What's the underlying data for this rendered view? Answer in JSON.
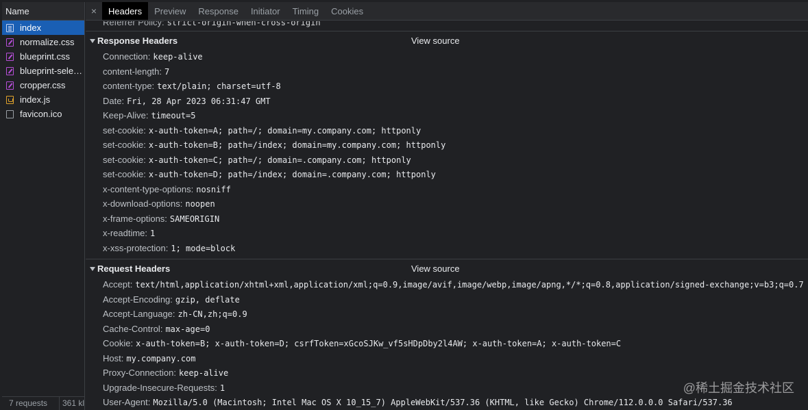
{
  "sidebar": {
    "header": "Name",
    "files": [
      {
        "name": "index",
        "icon": "document-icon",
        "type": "doc",
        "selected": true
      },
      {
        "name": "normalize.css",
        "icon": "css-file-icon",
        "type": "css"
      },
      {
        "name": "blueprint.css",
        "icon": "css-file-icon",
        "type": "css"
      },
      {
        "name": "blueprint-sele…",
        "icon": "css-file-icon",
        "type": "css"
      },
      {
        "name": "cropper.css",
        "icon": "css-file-icon",
        "type": "css"
      },
      {
        "name": "index.js",
        "icon": "js-file-icon",
        "type": "js"
      },
      {
        "name": "favicon.ico",
        "icon": "image-file-icon",
        "type": "blank"
      }
    ],
    "footer": {
      "requests": "7 requests",
      "size": "361 kl"
    }
  },
  "tabs": {
    "close": "×",
    "items": [
      {
        "label": "Headers",
        "active": true
      },
      {
        "label": "Preview"
      },
      {
        "label": "Response"
      },
      {
        "label": "Initiator"
      },
      {
        "label": "Timing"
      },
      {
        "label": "Cookies"
      }
    ]
  },
  "partial_header": {
    "name": "Referrer Policy:",
    "value": "strict-origin-when-cross-origin"
  },
  "response_headers": {
    "title": "Response Headers",
    "view_source": "View source",
    "items": [
      {
        "name": "Connection:",
        "value": "keep-alive"
      },
      {
        "name": "content-length:",
        "value": "7"
      },
      {
        "name": "content-type:",
        "value": "text/plain; charset=utf-8"
      },
      {
        "name": "Date:",
        "value": "Fri, 28 Apr 2023 06:31:47 GMT"
      },
      {
        "name": "Keep-Alive:",
        "value": "timeout=5"
      },
      {
        "name": "set-cookie:",
        "value": "x-auth-token=A; path=/; domain=my.company.com; httponly"
      },
      {
        "name": "set-cookie:",
        "value": "x-auth-token=B; path=/index; domain=my.company.com; httponly"
      },
      {
        "name": "set-cookie:",
        "value": "x-auth-token=C; path=/; domain=.company.com; httponly"
      },
      {
        "name": "set-cookie:",
        "value": "x-auth-token=D; path=/index; domain=.company.com; httponly"
      },
      {
        "name": "x-content-type-options:",
        "value": "nosniff"
      },
      {
        "name": "x-download-options:",
        "value": "noopen"
      },
      {
        "name": "x-frame-options:",
        "value": "SAMEORIGIN"
      },
      {
        "name": "x-readtime:",
        "value": "1"
      },
      {
        "name": "x-xss-protection:",
        "value": "1; mode=block"
      }
    ]
  },
  "request_headers": {
    "title": "Request Headers",
    "view_source": "View source",
    "items": [
      {
        "name": "Accept:",
        "value": "text/html,application/xhtml+xml,application/xml;q=0.9,image/avif,image/webp,image/apng,*/*;q=0.8,application/signed-exchange;v=b3;q=0.7"
      },
      {
        "name": "Accept-Encoding:",
        "value": "gzip, deflate"
      },
      {
        "name": "Accept-Language:",
        "value": "zh-CN,zh;q=0.9"
      },
      {
        "name": "Cache-Control:",
        "value": "max-age=0"
      },
      {
        "name": "Cookie:",
        "value": "x-auth-token=B; x-auth-token=D; csrfToken=xGcoSJKw_vf5sHDpDby2l4AW; x-auth-token=A; x-auth-token=C"
      },
      {
        "name": "Host:",
        "value": "my.company.com"
      },
      {
        "name": "Proxy-Connection:",
        "value": "keep-alive"
      },
      {
        "name": "Upgrade-Insecure-Requests:",
        "value": "1"
      },
      {
        "name": "User-Agent:",
        "value": "Mozilla/5.0 (Macintosh; Intel Mac OS X 10_15_7) AppleWebKit/537.36 (KHTML, like Gecko) Chrome/112.0.0.0 Safari/537.36"
      }
    ]
  },
  "watermark": "@稀土掘金技术社区"
}
